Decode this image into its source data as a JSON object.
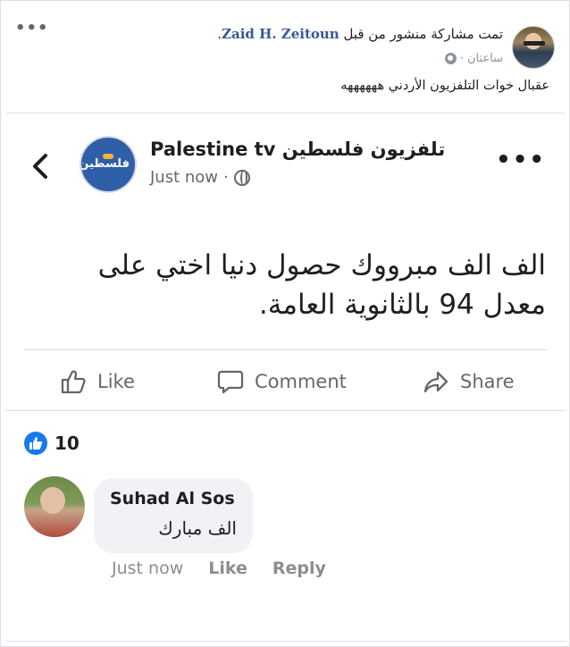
{
  "outer_post": {
    "actor": "Zaid H. Zeitoun",
    "shared_text": "تمت مشاركة منشور من قبل",
    "trailing_dot": ".",
    "time": "ساعتان",
    "meta_separator": "·",
    "caption": "عقبال خوات التلفزيون الأردني ههههههه"
  },
  "inner_post": {
    "page_name": "Palestine tv تلفزيون فلسطين",
    "avatar_text": "فلسطين",
    "timestamp": "Just now",
    "meta_separator": "·",
    "body": "الف الف مبرووك حصول دنيا اختي على معدل 94 بالثانوية العامة.",
    "actions": {
      "like": "Like",
      "comment": "Comment",
      "share": "Share"
    },
    "reactions": {
      "count": "10"
    },
    "comment": {
      "author": "Suhad Al Sos",
      "text": "الف مبارك",
      "time": "Just now",
      "like": "Like",
      "reply": "Reply"
    }
  },
  "colors": {
    "accent": "#1877f2",
    "link": "#385898",
    "secondary": "#65676b"
  },
  "icons": [
    "more-icon",
    "globe-icon",
    "back-chevron-icon",
    "thumbs-up-icon",
    "comment-icon",
    "share-icon",
    "like-reaction-icon"
  ]
}
